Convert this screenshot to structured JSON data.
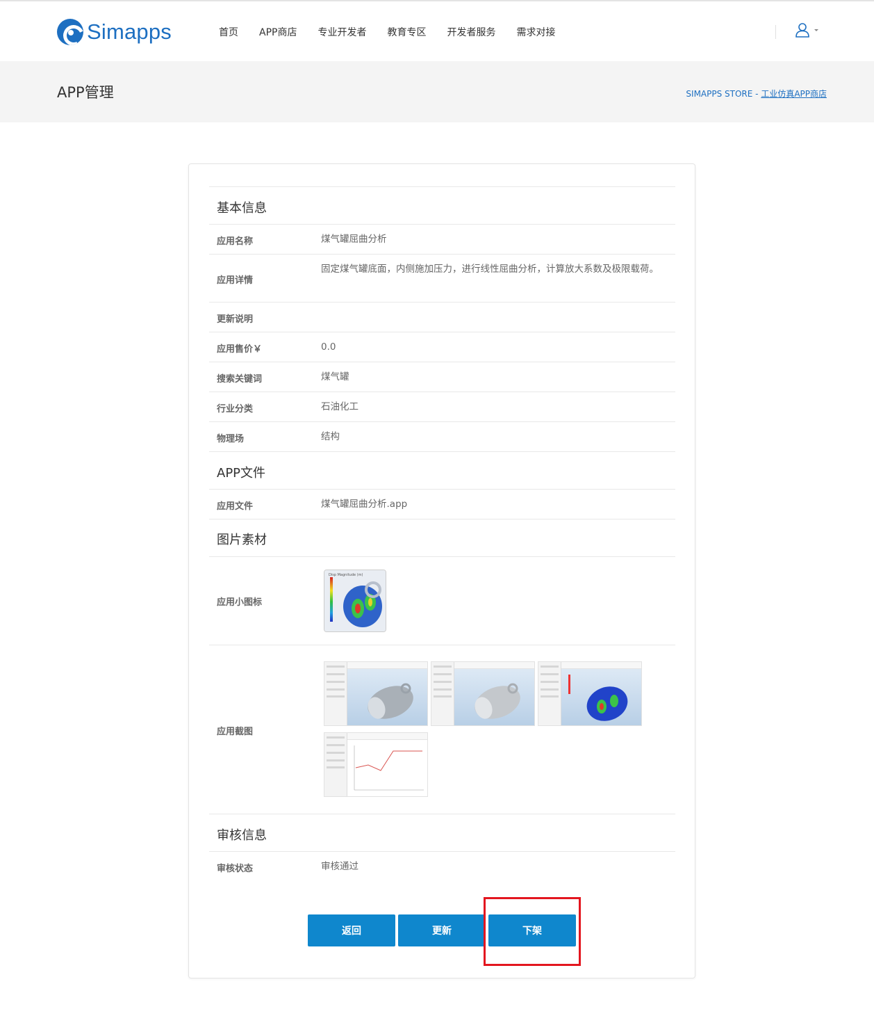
{
  "header": {
    "logo_text": "Simapps",
    "nav": [
      "首页",
      "APP商店",
      "专业开发者",
      "教育专区",
      "开发者服务",
      "需求对接"
    ]
  },
  "band": {
    "title": "APP管理",
    "breadcrumb_prefix": "SIMAPPS STORE - ",
    "breadcrumb_link": "工业仿真APP商店"
  },
  "sections": {
    "basic": "基本信息",
    "file": "APP文件",
    "images": "图片素材",
    "review": "审核信息"
  },
  "basic_info": {
    "name_label": "应用名称",
    "name_value": "煤气罐屈曲分析",
    "detail_label": "应用详情",
    "detail_value": "固定煤气罐底面，内侧施加压力，进行线性屈曲分析，计算放大系数及极限载荷。",
    "update_label": "更新说明",
    "update_value": "",
    "price_label": "应用售价￥",
    "price_value": "0.0",
    "keyword_label": "搜索关键词",
    "keyword_value": "煤气罐",
    "industry_label": "行业分类",
    "industry_value": "石油化工",
    "physics_label": "物理场",
    "physics_value": "结构"
  },
  "app_file": {
    "label": "应用文件",
    "value": "煤气罐屈曲分析.app"
  },
  "image_assets": {
    "icon_label": "应用小图标",
    "screenshots_label": "应用截图",
    "screenshot_count": 4
  },
  "review_info": {
    "status_label": "审核状态",
    "status_value": "审核通过"
  },
  "buttons": {
    "back": "返回",
    "update": "更新",
    "unpublish": "下架"
  },
  "colors": {
    "brand": "#1d6fc1",
    "button": "#0f87cd",
    "highlight": "#e3161f"
  }
}
